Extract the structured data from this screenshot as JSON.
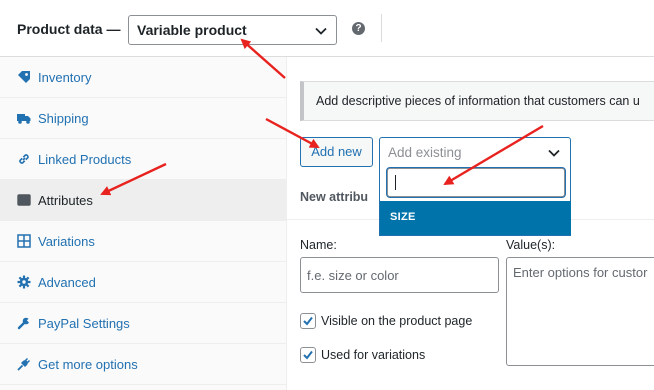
{
  "header": {
    "title": "Product data —",
    "product_type": "Variable product",
    "help_icon": "help-icon"
  },
  "sidebar": {
    "items": [
      {
        "label": "Inventory",
        "icon": "tag-icon"
      },
      {
        "label": "Shipping",
        "icon": "truck-icon"
      },
      {
        "label": "Linked Products",
        "icon": "link-icon"
      },
      {
        "label": "Attributes",
        "icon": "list-icon",
        "active": true
      },
      {
        "label": "Variations",
        "icon": "grid-icon"
      },
      {
        "label": "Advanced",
        "icon": "gear-icon"
      },
      {
        "label": "PayPal Settings",
        "icon": "wrench-icon"
      },
      {
        "label": "Get more options",
        "icon": "plug-icon"
      }
    ]
  },
  "attributes": {
    "notice": "Add descriptive pieces of information that customers can u",
    "add_new_label": "Add new",
    "add_existing_placeholder": "Add existing",
    "dropdown_option": "SIZE",
    "section_title": "New attribu",
    "name_label": "Name:",
    "name_placeholder": "f.e. size or color",
    "values_label": "Value(s):",
    "values_placeholder": "Enter options for custor",
    "visible_label": "Visible on the product page",
    "visible_checked": true,
    "variations_label": "Used for variations",
    "variations_checked": true
  },
  "colors": {
    "link": "#2271b1",
    "highlight": "#0073aa",
    "annotation_arrow": "#e8231f"
  }
}
